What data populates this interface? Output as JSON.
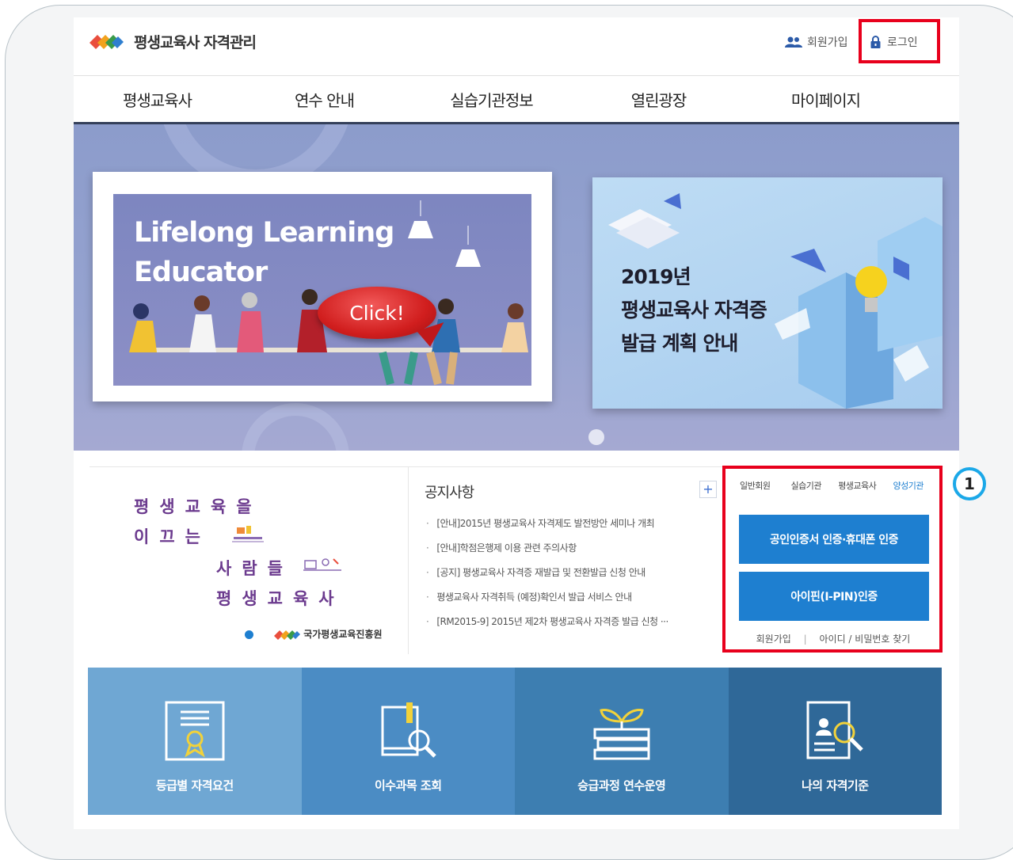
{
  "header": {
    "site_title": "평생교육사 자격관리",
    "join_label": "회원가입",
    "login_label": "로그인"
  },
  "nav": {
    "items": [
      {
        "label": "평생교육사"
      },
      {
        "label": "연수 안내"
      },
      {
        "label": "실습기관정보"
      },
      {
        "label": "열린광장"
      },
      {
        "label": "마이페이지"
      }
    ]
  },
  "banner": {
    "title_line1": "Lifelong Learning",
    "title_line2": "Educator",
    "click_label": "Click!",
    "promo_line1": "2019년",
    "promo_line2": "평생교육사 자격증",
    "promo_line3": "발급 계획 안내"
  },
  "slogan": {
    "line1": "평생교육을",
    "line2": "이끄는",
    "line3": "사람들",
    "line4": "평생교육사",
    "org": "국가평생교육진흥원"
  },
  "notice": {
    "title": "공지사항",
    "more_label": "+",
    "items": [
      "[안내]2015년 평생교육사 자격제도 발전방안 세미나 개최",
      "[안내]학점은행제 이용 관련 주의사항",
      "[공지] 평생교육사 자격증 재발급 및 전환발급 신청 안내",
      "평생교육사 자격취득 (예정)확인서 발급 서비스 안내",
      "[RM2015-9] 2015년 제2차 평생교육사 자격증 발급 신청 ···"
    ]
  },
  "login_panel": {
    "tabs": [
      {
        "label": "일반회원"
      },
      {
        "label": "실습기관"
      },
      {
        "label": "평생교육사"
      },
      {
        "label": "양성기관"
      }
    ],
    "cert_button": "공인인증서 인증·휴대폰 인증",
    "ipin_button": "아이핀(I-PIN)인증",
    "join_link": "회원가입",
    "separator": "|",
    "find_link": "아이디 / 비밀번호 찾기"
  },
  "step_badge": "1",
  "tiles": [
    {
      "label": "등급별 자격요건",
      "color": "#6fa7d3"
    },
    {
      "label": "이수과목 조회",
      "color": "#4b8cc4"
    },
    {
      "label": "승급과정 연수운영",
      "color": "#3d7eb1"
    },
    {
      "label": "나의 자격기준",
      "color": "#2f6898"
    }
  ],
  "colors": {
    "accent_blue": "#1e7fd0",
    "highlight_red": "#e8001c",
    "nav_border": "#34405a",
    "slogan_purple": "#6b3a8e"
  }
}
